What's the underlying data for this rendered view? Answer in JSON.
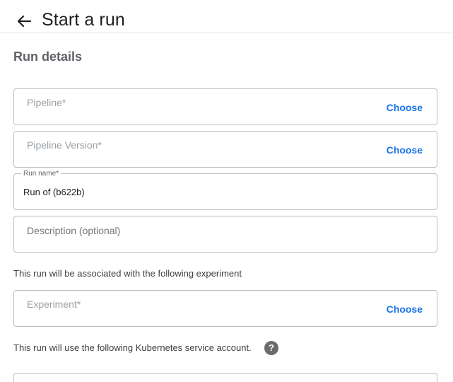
{
  "header": {
    "title": "Start a run",
    "back_icon": "arrow-left-icon"
  },
  "run_details": {
    "title": "Run details",
    "pipeline": {
      "placeholder": "Pipeline*",
      "action": "Choose"
    },
    "pipeline_version": {
      "placeholder": "Pipeline Version*",
      "action": "Choose"
    },
    "run_name": {
      "label": "Run name*",
      "value": "Run of  (b622b)"
    },
    "description": {
      "placeholder": "Description (optional)"
    }
  },
  "experiment_section": {
    "info": "This run will be associated with the following experiment",
    "experiment": {
      "placeholder": "Experiment*",
      "action": "Choose"
    }
  },
  "service_account_section": {
    "info": "This run will use the following Kubernetes service account.",
    "help_icon": "help-circle-icon",
    "help_glyph": "?"
  },
  "colors": {
    "accent": "#1a73e8",
    "border": "#bdbdbd",
    "help_icon_bg": "#6b6b6b"
  }
}
